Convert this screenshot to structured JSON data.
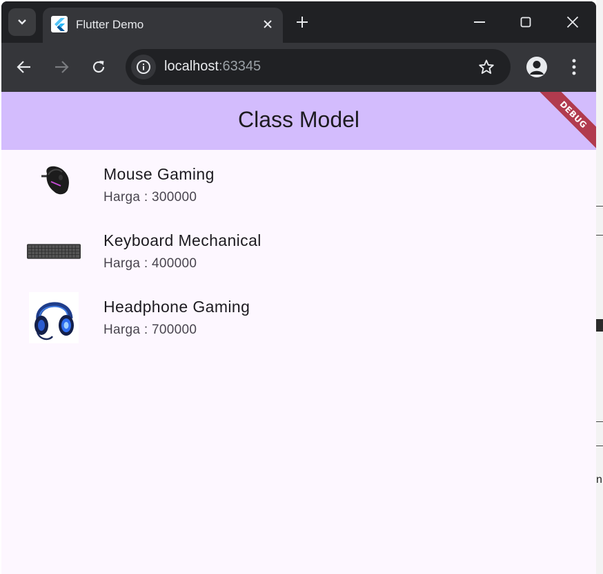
{
  "browser": {
    "tab": {
      "title": "Flutter Demo",
      "favicon": "flutter-logo"
    },
    "url": {
      "host": "localhost",
      "port": ":63345"
    },
    "icons": {
      "tab_search": "chevron-down-icon",
      "tab_close": "close-icon",
      "new_tab": "plus-icon",
      "back": "arrow-left-icon",
      "forward": "arrow-right-icon",
      "reload": "reload-icon",
      "site_info": "info-icon",
      "bookmark": "star-icon",
      "profile": "account-icon",
      "menu": "more-vert-icon"
    }
  },
  "app": {
    "title": "Class Model",
    "debug_banner": "DEBUG",
    "colors": {
      "appbar": "#d3bcfd",
      "background": "#fdf7ff",
      "banner": "#b13b4e"
    },
    "items": [
      {
        "name": "Mouse Gaming",
        "price": "Harga : 300000",
        "image": "gaming-mouse"
      },
      {
        "name": "Keyboard Mechanical",
        "price": "Harga : 400000",
        "image": "mechanical-keyboard"
      },
      {
        "name": "Headphone Gaming",
        "price": "Harga : 700000",
        "image": "gaming-headphone"
      }
    ]
  }
}
